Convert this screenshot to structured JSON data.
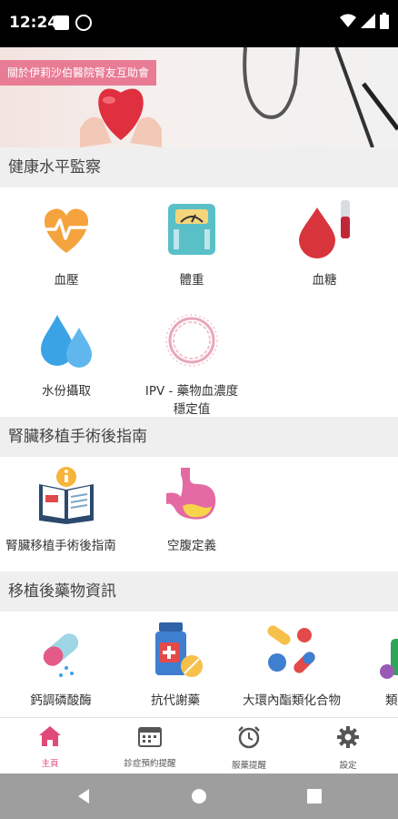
{
  "status_bar": {
    "time": "12:24"
  },
  "banner": {
    "label": "關於伊莉沙伯醫院腎友互助會"
  },
  "sections": [
    {
      "title": "健康水平監察",
      "items": [
        {
          "label": "血壓",
          "icon": "heart-pulse-icon"
        },
        {
          "label": "體重",
          "icon": "weighing-scale-icon"
        },
        {
          "label": "血糖",
          "icon": "blood-drop-icon"
        },
        {
          "label": "水份攝取",
          "icon": "water-drops-icon"
        },
        {
          "label": "IPV - 藥物血濃度穩定值",
          "icon": "ipv-ring-icon"
        }
      ]
    },
    {
      "title": "腎臟移植手術後指南",
      "items": [
        {
          "label": "腎臟移植手術後指南",
          "icon": "info-book-icon"
        },
        {
          "label": "空腹定義",
          "icon": "stomach-icon"
        }
      ]
    },
    {
      "title": "移植後藥物資訊",
      "items": [
        {
          "label": "鈣調磷酸酶",
          "icon": "capsule-icon"
        },
        {
          "label": "抗代謝藥",
          "icon": "medicine-bottle-icon"
        },
        {
          "label": "大環內酯類化合物",
          "icon": "pills-icon"
        },
        {
          "label": "類",
          "icon": "pills-partial-icon"
        }
      ]
    }
  ],
  "bottom_nav": [
    {
      "label": "主頁",
      "icon": "home-icon",
      "active": true
    },
    {
      "label": "診症預約提醒",
      "icon": "calendar-icon"
    },
    {
      "label": "服藥提醒",
      "icon": "alarm-clock-icon"
    },
    {
      "label": "設定",
      "icon": "gear-icon"
    }
  ],
  "colors": {
    "accent": "#e04a78",
    "banner_label_bg": "#e97c95",
    "section_bg": "#efefef"
  }
}
